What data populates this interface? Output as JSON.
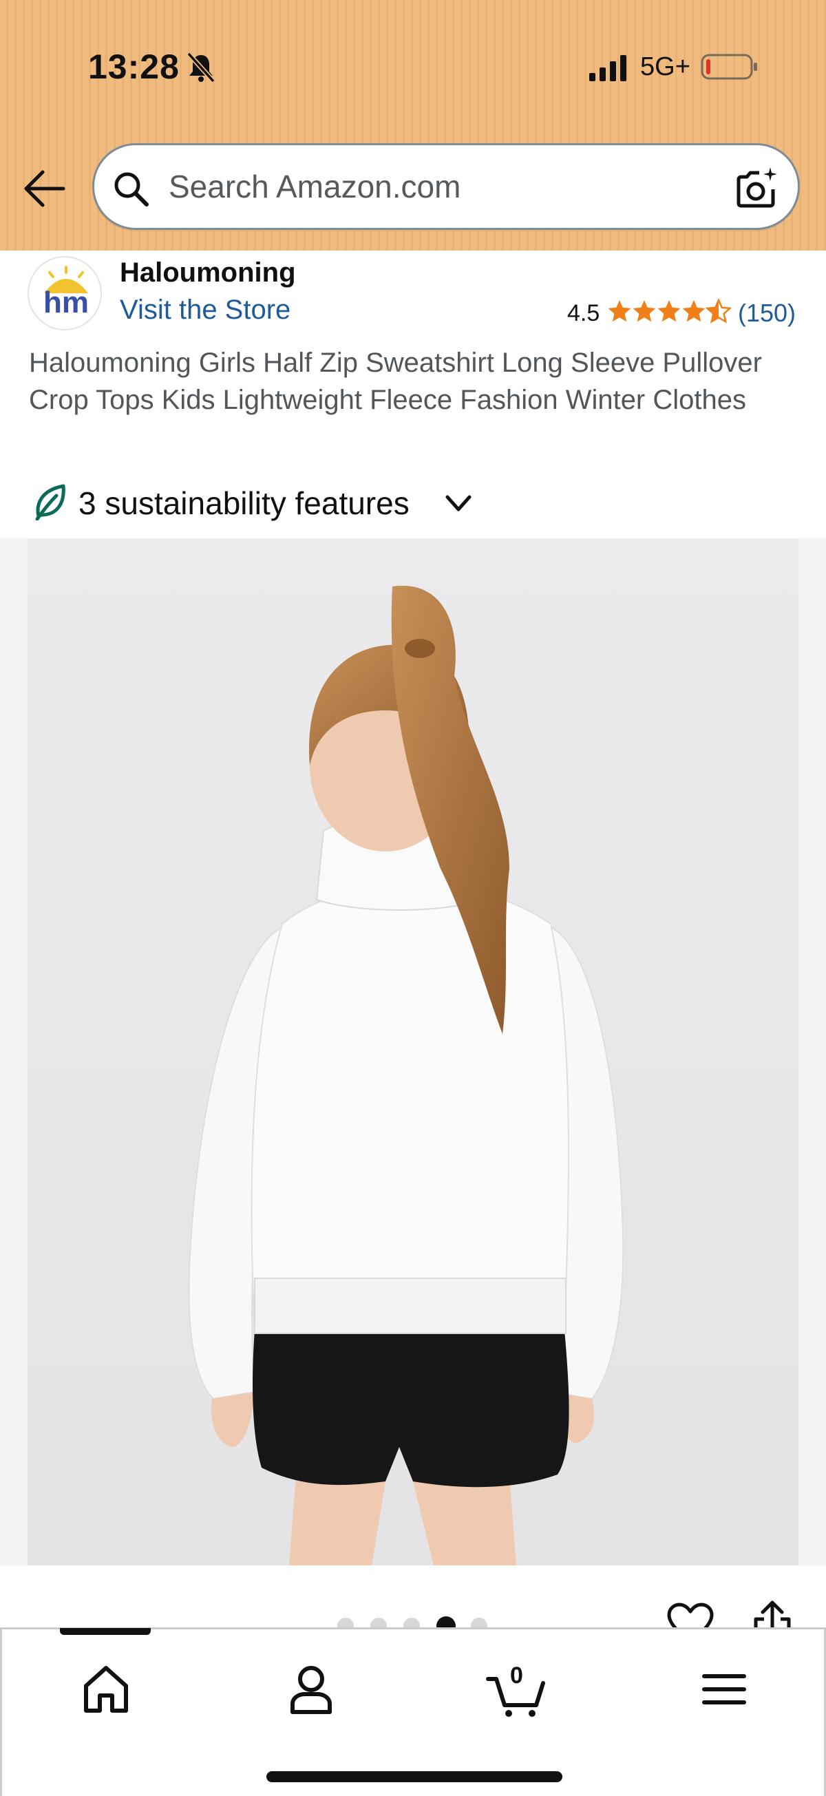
{
  "status_bar": {
    "time": "13:28",
    "network": "5G+"
  },
  "search": {
    "placeholder": "Search Amazon.com",
    "value": ""
  },
  "brand": {
    "name": "Haloumoning",
    "store_link": "Visit the Store",
    "logo_text": "hm"
  },
  "rating": {
    "value": "4.5",
    "stars": 4.5,
    "review_count": "(150)",
    "star_color": "#f17f17"
  },
  "product": {
    "title": "Haloumoning Girls Half Zip Sweatshirt Long Sleeve Pullover Crop Tops Kids Lightweight Fleece Fashion Winter Clothes"
  },
  "sustainability": {
    "label": "3 sustainability features"
  },
  "gallery": {
    "image_count": 5,
    "active_index": 3
  },
  "nav": {
    "items": [
      "home",
      "account",
      "cart",
      "menu"
    ],
    "cart_count": "0"
  },
  "colors": {
    "header_bg": "#efbb7f",
    "link": "#1e5b9a",
    "leaf": "#0a6b58"
  }
}
